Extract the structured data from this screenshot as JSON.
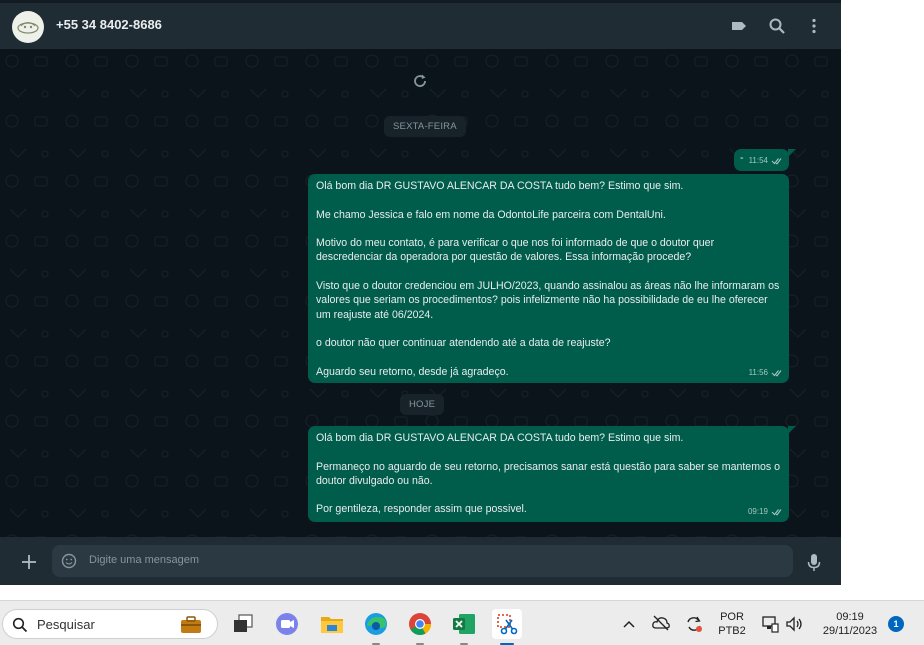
{
  "header": {
    "contact_name": "+55 34 8402-8686",
    "icons": [
      "avatar",
      "labels-icon",
      "search-icon",
      "menu-icon"
    ]
  },
  "chat": {
    "date_chips": {
      "friday": "SEXTA-FEIRA",
      "today": "HOJE"
    },
    "messages": [
      {
        "text": "-",
        "time": "11:54",
        "status": "read"
      },
      {
        "text": "Olá bom dia DR GUSTAVO ALENCAR DA COSTA tudo bem? Estimo que sim.\n\nMe chamo Jessica e falo em nome da OdontoLife parceira com DentalUni.\n\nMotivo do meu contato, é para verificar o que nos foi informado de que o doutor quer descredenciar da operadora por questão de valores. Essa informação procede?\n\nVisto que o doutor credenciou em JULHO/2023, quando assinalou as áreas não lhe informaram os valores que seriam os procedimentos? pois infelizmente não ha possibilidade de eu lhe oferecer um reajuste até 06/2024.\n\no doutor não quer continuar atendendo até a data de reajuste?\n\nAguardo seu retorno, desde já agradeço.",
        "time": "11:56",
        "status": "read"
      },
      {
        "text": "Olá bom dia DR GUSTAVO ALENCAR DA COSTA tudo bem? Estimo que sim.\n\nPermaneço no aguardo de seu retorno, precisamos sanar está questão para saber se mantemos o doutor divulgado ou não.\n\nPor gentileza, responder assim que possivel.",
        "time": "09:19",
        "status": "read"
      }
    ]
  },
  "composer": {
    "placeholder": "Digite uma mensagem"
  },
  "taskbar": {
    "search_placeholder": "Pesquisar",
    "apps": [
      "work-app",
      "task-view",
      "teams",
      "file-explorer",
      "edge",
      "chrome",
      "excel",
      "snipping-tool"
    ],
    "language_line1": "POR",
    "language_line2": "PTB2",
    "time": "09:19",
    "date": "29/11/2023",
    "notification_count": "1"
  },
  "colors": {
    "chat_bg": "#0b141a",
    "header_bg": "#202c33",
    "outgoing_bubble": "#005c4b",
    "read_ticks": "#a4c7bd",
    "accent_blue": "#0067c0"
  }
}
